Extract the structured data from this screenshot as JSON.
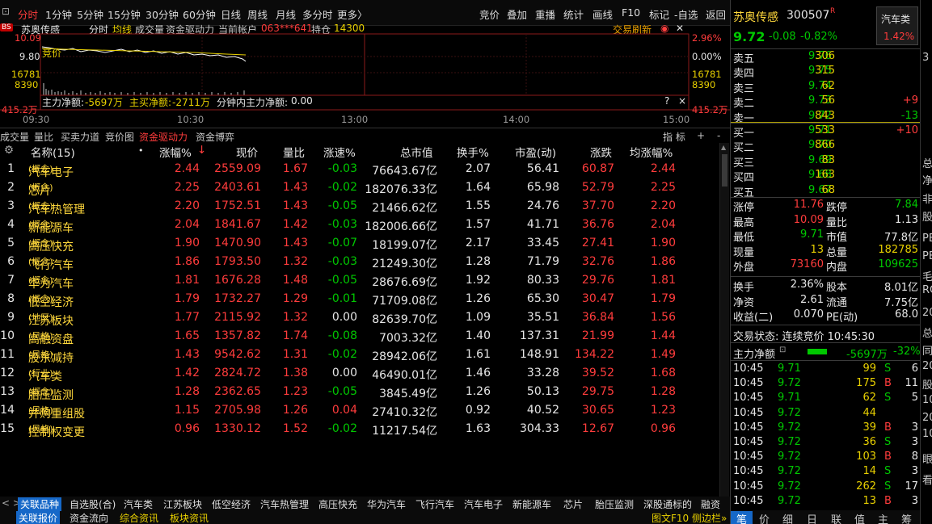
{
  "menu": {
    "items": [
      "分时",
      "1分钟",
      "5分钟",
      "15分钟",
      "30分钟",
      "60分钟",
      "日线",
      "周线",
      "月线",
      "多分时",
      "更多〉"
    ],
    "active": 0,
    "right": [
      "竞价",
      "叠加",
      "重播",
      "统计",
      "画线",
      "F10",
      "标记",
      "-自选",
      "返回"
    ]
  },
  "chart": {
    "name": "苏奥传感",
    "labels": [
      "分时",
      "均线",
      "成交量",
      "资金驱动力",
      "当前帐户"
    ],
    "account": "063***641",
    "holding_label": "持仓",
    "holding": "14300",
    "refresh": "交易刷新",
    "y_top": "10.09",
    "y_mid": "9.80",
    "y_vol1": "16781",
    "y_vol2": "8390",
    "y_amt": "415.2万",
    "pct_top": "2.96%",
    "pct_mid": "0.00%",
    "vol_r1": "16781",
    "vol_r2": "8390",
    "amt_r": "415.2万",
    "bs": "BS",
    "auction": "竞价",
    "flow_label": "主力净额:",
    "flow_val": "-5697万",
    "buy_label": "主买净额:",
    "buy_val": "-2711万",
    "minute_label": "分钟内主力净额:",
    "minute_val": "0.00",
    "times": [
      "09:30",
      "10:30",
      "13:00",
      "14:00",
      "15:00"
    ],
    "help": "?",
    "close": "×"
  },
  "subtabs": [
    "成交量",
    "量比",
    "买卖力道",
    "竞价图",
    "资金驱动力",
    "资金博弈"
  ],
  "subtab_active": 4,
  "idx_label": "指 标",
  "plus": "+",
  "minus": "-",
  "table": {
    "headers": [
      "名称(15)",
      "•",
      "涨幅%",
      "现价",
      "量比",
      "涨速%",
      "总市值",
      "换手%",
      "市盈(动)",
      "涨跌",
      "均涨幅%"
    ],
    "sort_arrow": "↓",
    "rows": [
      {
        "no": "1",
        "name": "汽车电子",
        "tag": "(概念)",
        "chg": "2.44",
        "price": "2559.09",
        "ratio": "1.67",
        "speed": "-0.03",
        "mcap": "76643.67亿",
        "turn": "2.07",
        "pe": "56.41",
        "diff": "60.87",
        "avg": "2.44"
      },
      {
        "no": "2",
        "name": "芯片",
        "tag": "(概念)",
        "chg": "2.25",
        "price": "2403.61",
        "ratio": "1.43",
        "speed": "-0.02",
        "mcap": "182076.33亿",
        "turn": "1.64",
        "pe": "65.98",
        "diff": "52.79",
        "avg": "2.25"
      },
      {
        "no": "3",
        "name": "汽车热管理",
        "tag": "(概念)",
        "chg": "2.20",
        "price": "1752.51",
        "ratio": "1.43",
        "speed": "-0.05",
        "mcap": "21466.62亿",
        "turn": "1.55",
        "pe": "24.76",
        "diff": "37.70",
        "avg": "2.20"
      },
      {
        "no": "4",
        "name": "新能源车",
        "tag": "(概念)",
        "chg": "2.04",
        "price": "1841.67",
        "ratio": "1.42",
        "speed": "-0.03",
        "mcap": "182006.66亿",
        "turn": "1.57",
        "pe": "41.71",
        "diff": "36.76",
        "avg": "2.04"
      },
      {
        "no": "5",
        "name": "高压快充",
        "tag": "(概念)",
        "chg": "1.90",
        "price": "1470.90",
        "ratio": "1.43",
        "speed": "-0.07",
        "mcap": "18199.07亿",
        "turn": "2.17",
        "pe": "33.45",
        "diff": "27.41",
        "avg": "1.90"
      },
      {
        "no": "6",
        "name": "飞行汽车",
        "tag": "(概念)",
        "chg": "1.86",
        "price": "1793.50",
        "ratio": "1.32",
        "speed": "-0.03",
        "mcap": "21249.30亿",
        "turn": "1.28",
        "pe": "71.79",
        "diff": "32.76",
        "avg": "1.86"
      },
      {
        "no": "7",
        "name": "华为汽车",
        "tag": "(概念)",
        "chg": "1.81",
        "price": "1676.28",
        "ratio": "1.48",
        "speed": "-0.05",
        "mcap": "28676.69亿",
        "turn": "1.92",
        "pe": "80.33",
        "diff": "29.76",
        "avg": "1.81"
      },
      {
        "no": "8",
        "name": "低空经济",
        "tag": "(概念)",
        "chg": "1.79",
        "price": "1732.27",
        "ratio": "1.29",
        "speed": "-0.01",
        "mcap": "71709.08亿",
        "turn": "1.26",
        "pe": "65.30",
        "diff": "30.47",
        "avg": "1.79"
      },
      {
        "no": "9",
        "name": "江苏板块",
        "tag": "(地区)",
        "chg": "1.77",
        "price": "2115.92",
        "ratio": "1.32",
        "speed": "0.00",
        "mcap": "82639.70亿",
        "turn": "1.09",
        "pe": "35.51",
        "diff": "36.84",
        "avg": "1.56"
      },
      {
        "no": "10",
        "name": "高融资盘",
        "tag": "(风格)",
        "chg": "1.65",
        "price": "1357.82",
        "ratio": "1.74",
        "speed": "-0.08",
        "mcap": "7003.32亿",
        "turn": "1.40",
        "pe": "137.31",
        "diff": "21.99",
        "avg": "1.44"
      },
      {
        "no": "11",
        "name": "股东减持",
        "tag": "(风格)",
        "chg": "1.43",
        "price": "9542.62",
        "ratio": "1.31",
        "speed": "-0.02",
        "mcap": "28942.06亿",
        "turn": "1.61",
        "pe": "148.91",
        "diff": "134.22",
        "avg": "1.49"
      },
      {
        "no": "12",
        "name": "汽车类",
        "tag": "(行业)",
        "chg": "1.42",
        "price": "2824.72",
        "ratio": "1.38",
        "speed": "0.00",
        "mcap": "46490.01亿",
        "turn": "1.46",
        "pe": "33.28",
        "diff": "39.52",
        "avg": "1.68"
      },
      {
        "no": "13",
        "name": "胎压监测",
        "tag": "(概念)",
        "chg": "1.28",
        "price": "2362.65",
        "ratio": "1.23",
        "speed": "-0.05",
        "mcap": "3845.49亿",
        "turn": "1.26",
        "pe": "50.13",
        "diff": "29.75",
        "avg": "1.28"
      },
      {
        "no": "14",
        "name": "并购重组股",
        "tag": "(风格)",
        "chg": "1.15",
        "price": "2705.98",
        "ratio": "1.26",
        "speed": "0.04",
        "mcap": "27410.32亿",
        "turn": "0.92",
        "pe": "40.52",
        "diff": "30.65",
        "avg": "1.23"
      },
      {
        "no": "15",
        "name": "控制权变更",
        "tag": "(风格)",
        "chg": "0.96",
        "price": "1330.12",
        "ratio": "1.52",
        "speed": "-0.02",
        "mcap": "11217.54亿",
        "turn": "1.63",
        "pe": "304.33",
        "diff": "12.67",
        "avg": "0.96"
      }
    ]
  },
  "bottom1": {
    "arrows": "< >",
    "items": [
      "关联品种",
      "自选股(合)",
      "汽车类",
      "江苏板块",
      "低空经济",
      "汽车热管理",
      "高压快充",
      "华为汽车",
      "飞行汽车",
      "汽车电子",
      "新能源车",
      "芯片",
      "胎压监测",
      "深股通标的",
      "融资"
    ],
    "active": 0
  },
  "bottom2": {
    "items": [
      "关联报价",
      "资金流向",
      "综合资讯",
      "板块资讯"
    ],
    "right": "图文F10 侧边栏»"
  },
  "right": {
    "name": "苏奥传感",
    "code": "300507",
    "r": "R",
    "price": "9.72",
    "chg": "-0.08",
    "pct": "-0.82%",
    "sector": "汽车类",
    "sector_pct": "1.42%",
    "asks": [
      {
        "l": "卖五",
        "p": "9.76",
        "v": "306",
        "d": ""
      },
      {
        "l": "卖四",
        "p": "9.75",
        "v": "315",
        "d": ""
      },
      {
        "l": "卖三",
        "p": "9.74",
        "v": "62",
        "d": ""
      },
      {
        "l": "卖二",
        "p": "9.73",
        "v": "56",
        "d": "+9"
      },
      {
        "l": "卖一",
        "p": "9.72",
        "v": "843",
        "d": "-13"
      }
    ],
    "bids": [
      {
        "l": "买一",
        "p": "9.71",
        "v": "533",
        "d": "+10"
      },
      {
        "l": "买二",
        "p": "9.70",
        "v": "866",
        "d": ""
      },
      {
        "l": "买三",
        "p": "9.69",
        "v": "83",
        "d": ""
      },
      {
        "l": "买四",
        "p": "9.68",
        "v": "163",
        "d": ""
      },
      {
        "l": "买五",
        "p": "9.67",
        "v": "68",
        "d": ""
      }
    ],
    "stats1": [
      [
        "涨停",
        "11.76",
        "跌停",
        "7.84"
      ],
      [
        "最高",
        "10.09",
        "量比",
        "1.13"
      ],
      [
        "最低",
        "9.71",
        "市值",
        "77.8亿"
      ],
      [
        "现量",
        "13",
        "总量",
        "182785"
      ],
      [
        "外盘",
        "73160",
        "内盘",
        "109625"
      ]
    ],
    "stats2": [
      [
        "换手",
        "2.36%",
        "股本",
        "8.01亿"
      ],
      [
        "净资",
        "2.61",
        "流通",
        "7.75亿"
      ],
      [
        "收益(二)",
        "0.070",
        "PE(动)",
        "68.0"
      ]
    ],
    "status": "交易状态: 连续竞价 10:45:30",
    "flow_label": "主力净额",
    "flow_val": "-5697万",
    "flow_pct": "-32%",
    "ticks": [
      [
        "10:45",
        "9.71",
        "99",
        "S",
        "6"
      ],
      [
        "10:45",
        "9.72",
        "175",
        "B",
        "11"
      ],
      [
        "10:45",
        "9.71",
        "62",
        "S",
        "5"
      ],
      [
        "10:45",
        "9.72",
        "44",
        "",
        ""
      ],
      [
        "10:45",
        "9.72",
        "39",
        "B",
        "3"
      ],
      [
        "10:45",
        "9.72",
        "36",
        "S",
        "3"
      ],
      [
        "10:45",
        "9.72",
        "103",
        "B",
        "8"
      ],
      [
        "10:45",
        "9.72",
        "14",
        "S",
        "3"
      ],
      [
        "10:45",
        "9.72",
        "262",
        "S",
        "17"
      ],
      [
        "10:45",
        "9.72",
        "13",
        "B",
        "3"
      ]
    ],
    "btabs": [
      "笔",
      "价",
      "细",
      "日",
      "联",
      "值",
      "主",
      "筹"
    ]
  },
  "edge": [
    "3",
    "总",
    "净",
    "非",
    "股",
    "PE",
    "PE",
    "毛",
    "RO",
    "20",
    "总",
    "同",
    "20",
    "股",
    "10",
    "20",
    "10",
    "眼",
    "看"
  ],
  "colors": {
    "up": "#ff3c3c",
    "down": "#00c800",
    "name": "#ffd83c"
  }
}
